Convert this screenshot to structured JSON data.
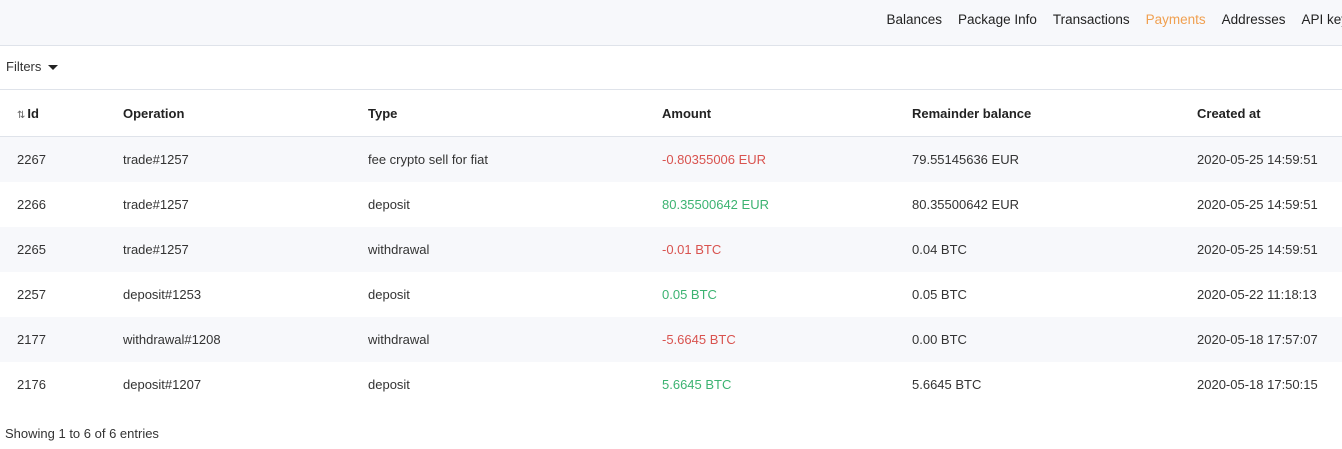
{
  "nav": {
    "items": [
      {
        "label": "Balances",
        "active": false
      },
      {
        "label": "Package Info",
        "active": false
      },
      {
        "label": "Transactions",
        "active": false
      },
      {
        "label": "Payments",
        "active": true
      },
      {
        "label": "Addresses",
        "active": false
      },
      {
        "label": "API key",
        "active": false
      }
    ]
  },
  "filters": {
    "label": "Filters",
    "icon": "caret-down-icon"
  },
  "table": {
    "headers": [
      "Id",
      "Operation",
      "Type",
      "Amount",
      "Remainder balance",
      "Created at"
    ],
    "sort_icon": "sort-icon",
    "rows": [
      {
        "id": "2267",
        "operation": "trade#1257",
        "type": "fee crypto sell for fiat",
        "amount": "-0.80355006 EUR",
        "amount_sign": "neg",
        "remainder": "79.55145636 EUR",
        "created": "2020-05-25 14:59:51"
      },
      {
        "id": "2266",
        "operation": "trade#1257",
        "type": "deposit",
        "amount": "80.35500642 EUR",
        "amount_sign": "pos",
        "remainder": "80.35500642 EUR",
        "created": "2020-05-25 14:59:51"
      },
      {
        "id": "2265",
        "operation": "trade#1257",
        "type": "withdrawal",
        "amount": "-0.01 BTC",
        "amount_sign": "neg",
        "remainder": "0.04 BTC",
        "created": "2020-05-25 14:59:51"
      },
      {
        "id": "2257",
        "operation": "deposit#1253",
        "type": "deposit",
        "amount": "0.05 BTC",
        "amount_sign": "pos",
        "remainder": "0.05 BTC",
        "created": "2020-05-22 11:18:13"
      },
      {
        "id": "2177",
        "operation": "withdrawal#1208",
        "type": "withdrawal",
        "amount": "-5.6645 BTC",
        "amount_sign": "neg",
        "remainder": "0.00 BTC",
        "created": "2020-05-18 17:57:07"
      },
      {
        "id": "2176",
        "operation": "deposit#1207",
        "type": "deposit",
        "amount": "5.6645 BTC",
        "amount_sign": "pos",
        "remainder": "5.6645 BTC",
        "created": "2020-05-18 17:50:15"
      }
    ]
  },
  "info": "Showing 1 to 6 of 6 entries",
  "colors": {
    "accent": "#f0a050",
    "negative": "#d9534f",
    "positive": "#3cb371",
    "stripe": "#f7f8fb"
  }
}
